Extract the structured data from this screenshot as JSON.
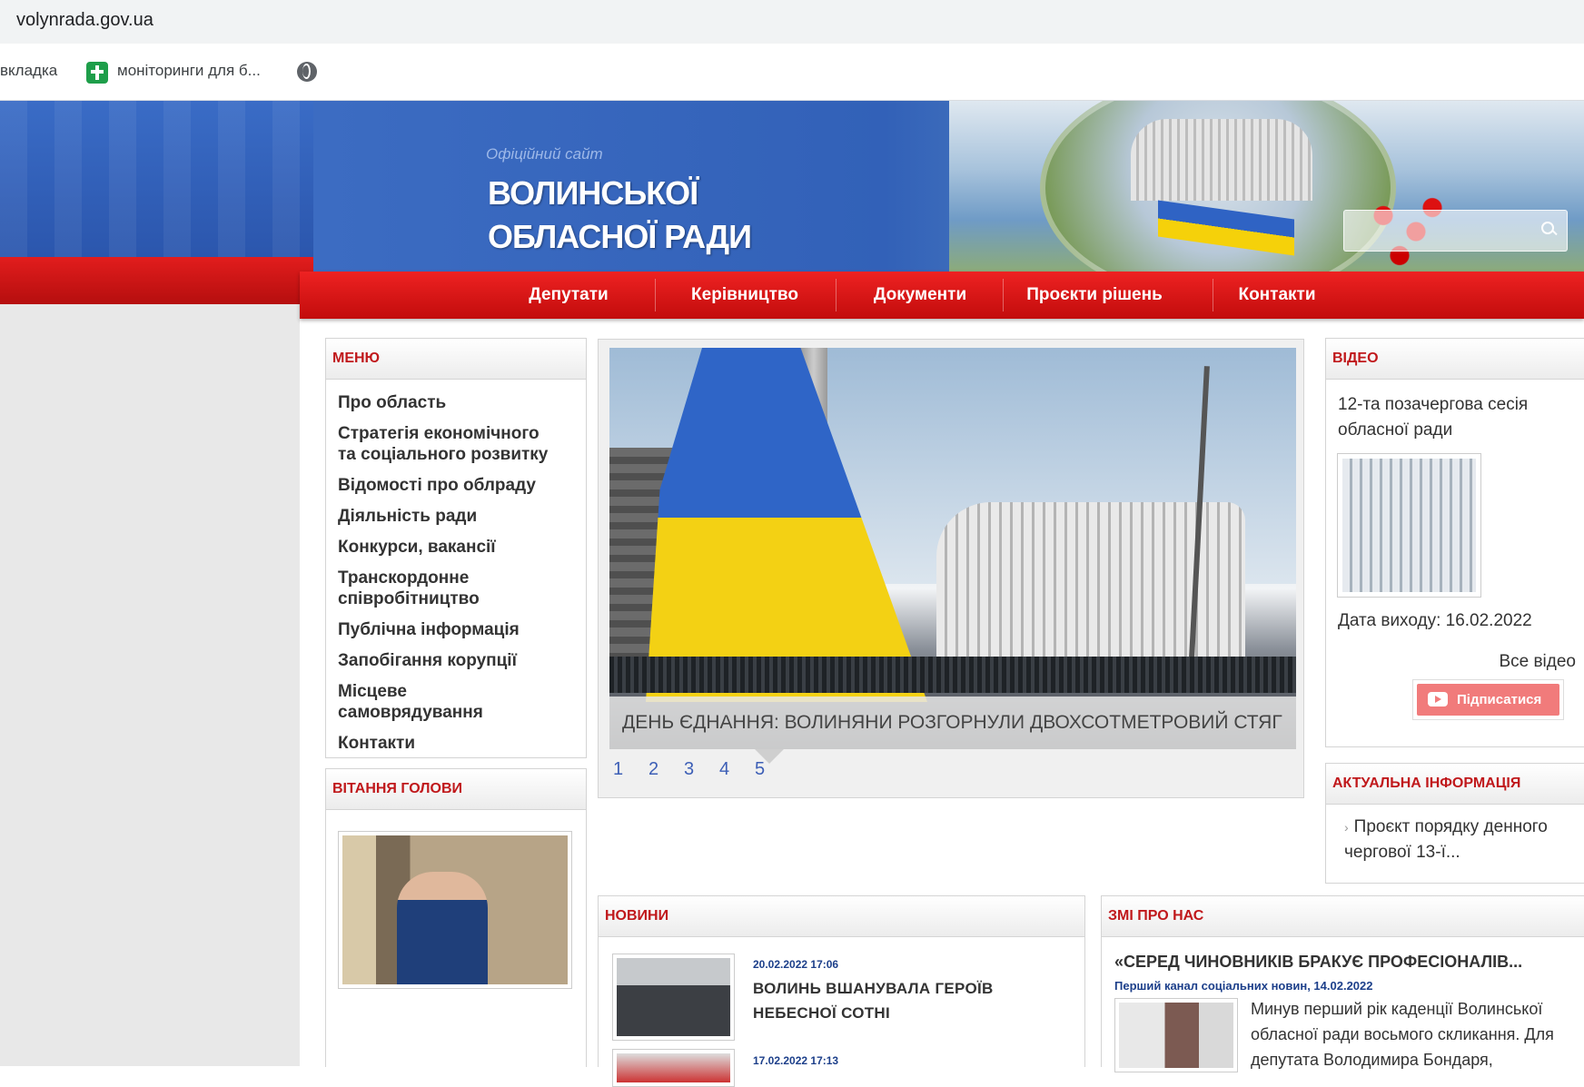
{
  "browser": {
    "url": "volynrada.gov.ua",
    "bookmarks": [
      "вкладка",
      "моніторинги для б..."
    ]
  },
  "header": {
    "subtitle": "Офіційний сайт",
    "title_line1": "ВОЛИНСЬКОЇ",
    "title_line2": "ОБЛАСНОЇ РАДИ"
  },
  "nav": [
    "Депутати",
    "Керівництво",
    "Документи",
    "Проєкти рішень",
    "Контакти"
  ],
  "menu": {
    "heading": "МЕНЮ",
    "items": [
      "Про область",
      "Стратегія економічного та соціального розвитку",
      "Відомості про облраду",
      "Діяльність ради",
      "Конкурси, вакансії",
      "Транскордонне співробітництво",
      "Публічна інформація",
      "Запобігання корупції",
      "Місцеве самоврядування",
      "Контакти"
    ]
  },
  "greeting": {
    "heading": "ВІТАННЯ ГОЛОВИ"
  },
  "slider": {
    "caption": "ДЕНЬ ЄДНАННЯ: ВОЛИНЯНИ РОЗГОРНУЛИ ДВОХСОТМЕТРОВИЙ СТЯГ",
    "pages": [
      "1",
      "2",
      "3",
      "4",
      "5"
    ],
    "current_page": 5
  },
  "video": {
    "heading": "ВІДЕО",
    "title": "12-та позачергова сесія обласної ради",
    "date": "Дата виходу: 16.02.2022",
    "all_label": "Все відео",
    "subscribe_label": "Підписатися"
  },
  "actual": {
    "heading": "АКТУАЛЬНА ІНФОРМАЦІЯ",
    "item": "Проєкт порядку денного чергової 13-ї..."
  },
  "news": {
    "heading": "НОВИНИ",
    "items": [
      {
        "date": "20.02.2022 17:06",
        "title": "ВОЛИНЬ ВШАНУВАЛА ГЕРОЇВ НЕБЕСНОЇ СОТНІ"
      },
      {
        "date": "17.02.2022 17:13",
        "title": ""
      }
    ]
  },
  "media": {
    "heading": "ЗМІ ПРО НАС",
    "title": "«СЕРЕД ЧИНОВНИКІВ БРАКУЄ ПРОФЕСІОНАЛІВ...",
    "source": "Перший канал соціальних новин, 14.02.2022",
    "text": "Минув перший рік каденції Волинської обласної ради восьмого скликання. Для депутата Володимира Бондаря,"
  }
}
